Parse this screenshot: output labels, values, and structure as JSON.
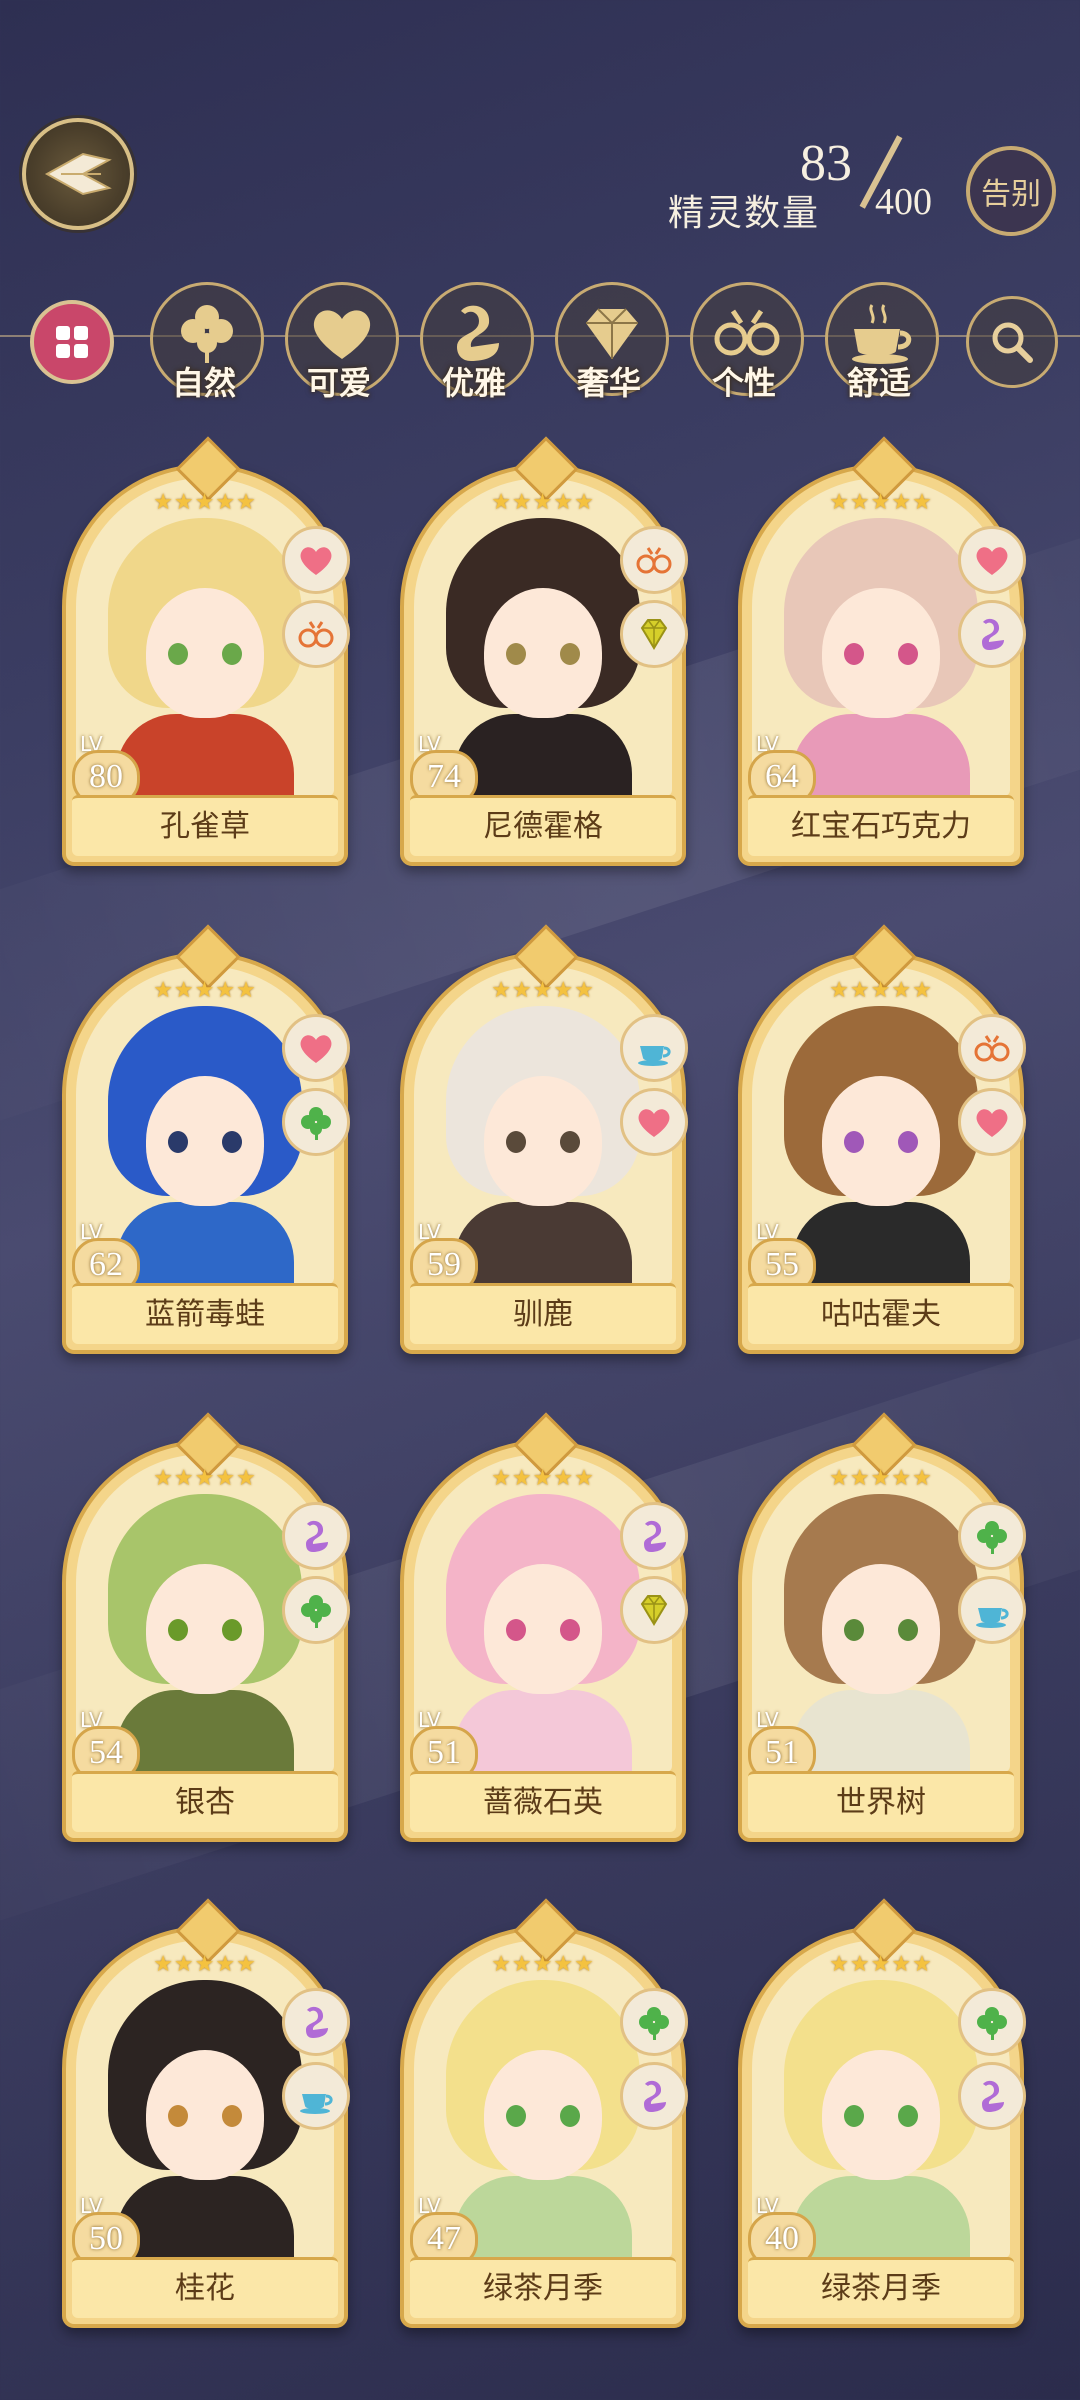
{
  "header": {
    "spirit_count_current": "83",
    "spirit_count_label": "精灵数量",
    "spirit_count_total": "400",
    "farewell_label": "告别"
  },
  "filters": [
    {
      "label": "自然",
      "icon": "clover-icon"
    },
    {
      "label": "可爱",
      "icon": "heart-icon"
    },
    {
      "label": "优雅",
      "icon": "swan-icon"
    },
    {
      "label": "奢华",
      "icon": "diamond-icon"
    },
    {
      "label": "个性",
      "icon": "glasses-icon"
    },
    {
      "label": "舒适",
      "icon": "teacup-icon"
    }
  ],
  "cards": [
    {
      "name": "孔雀草",
      "lv_label": "LV",
      "level": "80",
      "stars": "★★★★★",
      "tags": [
        "heart-icon",
        "glasses-icon"
      ]
    },
    {
      "name": "尼德霍格",
      "lv_label": "LV",
      "level": "74",
      "stars": "★★★★★",
      "tags": [
        "glasses-icon",
        "diamond-icon"
      ]
    },
    {
      "name": "红宝石巧克力",
      "lv_label": "LV",
      "level": "64",
      "stars": "★★★★★",
      "tags": [
        "heart-icon",
        "swan-icon"
      ]
    },
    {
      "name": "蓝箭毒蛙",
      "lv_label": "LV",
      "level": "62",
      "stars": "★★★★★",
      "tags": [
        "heart-icon",
        "clover-icon"
      ]
    },
    {
      "name": "驯鹿",
      "lv_label": "LV",
      "level": "59",
      "stars": "★★★★★",
      "tags": [
        "teacup-icon",
        "heart-icon"
      ]
    },
    {
      "name": "咕咕霍夫",
      "lv_label": "LV",
      "level": "55",
      "stars": "★★★★★",
      "tags": [
        "glasses-icon",
        "heart-icon"
      ]
    },
    {
      "name": "银杏",
      "lv_label": "LV",
      "level": "54",
      "stars": "★★★★★",
      "tags": [
        "swan-icon",
        "clover-icon"
      ]
    },
    {
      "name": "蔷薇石英",
      "lv_label": "LV",
      "level": "51",
      "stars": "★★★★★",
      "tags": [
        "swan-icon",
        "diamond-icon"
      ]
    },
    {
      "name": "世界树",
      "lv_label": "LV",
      "level": "51",
      "stars": "★★★★★",
      "tags": [
        "clover-icon",
        "teacup-icon"
      ]
    },
    {
      "name": "桂花",
      "lv_label": "LV",
      "level": "50",
      "stars": "★★★★★",
      "tags": [
        "swan-icon",
        "teacup-icon"
      ]
    },
    {
      "name": "绿茶月季",
      "lv_label": "LV",
      "level": "47",
      "stars": "★★★★★",
      "tags": [
        "clover-icon",
        "swan-icon"
      ]
    },
    {
      "name": "绿茶月季",
      "lv_label": "LV",
      "level": "40",
      "stars": "★★★★★",
      "tags": [
        "clover-icon",
        "swan-icon"
      ]
    }
  ],
  "colors": {
    "hair": [
      "#f0d78a",
      "#3a2a24",
      "#e8c7b8",
      "#2a5ac8",
      "#ece5dc",
      "#9c6a3a",
      "#a8c56a",
      "#f4b4c8",
      "#a67a4e",
      "#2c2422",
      "#f3e08c",
      "#f3e08c"
    ],
    "body": [
      "#c9432a",
      "#2a2222",
      "#e89ab8",
      "#2e68c8",
      "#4a3a34",
      "#2a2a2a",
      "#6a7a3a",
      "#f4c8d8",
      "#e8e4d0",
      "#2c2422",
      "#bcd79a",
      "#bcd79a"
    ],
    "eyes": [
      "#6aa84a",
      "#a08a4a",
      "#d4568a",
      "#2a3a6a",
      "#5a4a3a",
      "#a058b8",
      "#6a9a2a",
      "#d4568a",
      "#5a8a3a",
      "#c48a3a",
      "#5aa84a",
      "#5aa84a"
    ]
  }
}
